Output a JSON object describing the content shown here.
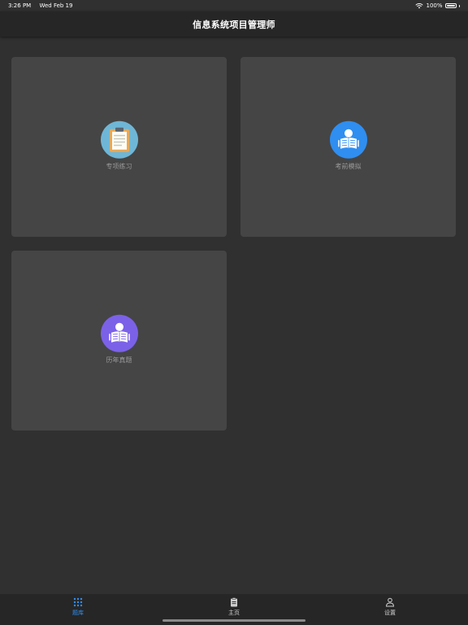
{
  "status_bar": {
    "time": "3:26 PM",
    "date": "Wed Feb 19",
    "battery": "100%",
    "wifi_icon": "wifi-icon",
    "battery_icon": "battery-icon"
  },
  "header": {
    "title": "信息系统项目管理师"
  },
  "cards": [
    {
      "label": "专项练习",
      "icon": "clipboard-icon",
      "icon_bg": "#6fb6d6"
    },
    {
      "label": "考前模拟",
      "icon": "reader-book-icon",
      "icon_bg": "#2f8ef0"
    },
    {
      "label": "历年真题",
      "icon": "reader-book-icon",
      "icon_bg": "#7b61e8"
    }
  ],
  "tabbar": {
    "tabs": [
      {
        "label": "题库",
        "icon": "grid-icon",
        "active": true
      },
      {
        "label": "主页",
        "icon": "clipboard-icon",
        "active": false
      },
      {
        "label": "设置",
        "icon": "person-icon",
        "active": false
      }
    ],
    "active_color": "#2f8ef0"
  },
  "colors": {
    "background": "#303030",
    "card": "#454545",
    "bars": "#262626"
  }
}
